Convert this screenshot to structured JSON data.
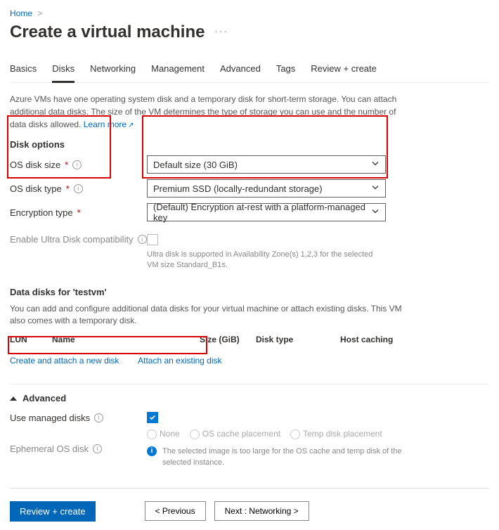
{
  "breadcrumb": {
    "home": "Home"
  },
  "title": "Create a virtual machine",
  "tabs": [
    "Basics",
    "Disks",
    "Networking",
    "Management",
    "Advanced",
    "Tags",
    "Review + create"
  ],
  "active_tab": "Disks",
  "intro": {
    "text": "Azure VMs have one operating system disk and a temporary disk for short-term storage. You can attach additional data disks. The size of the VM determines the type of storage you can use and the number of data disks allowed.",
    "learn_more": "Learn more"
  },
  "disk_options_title": "Disk options",
  "fields": {
    "os_disk_size": {
      "label": "OS disk size",
      "required": true,
      "value": "Default size (30 GiB)"
    },
    "os_disk_type": {
      "label": "OS disk type",
      "required": true,
      "value": "Premium SSD (locally-redundant storage)"
    },
    "encryption_type": {
      "label": "Encryption type",
      "required": true,
      "value": "(Default) Encryption at-rest with a platform-managed key"
    },
    "ultra_disk": {
      "label": "Enable Ultra Disk compatibility",
      "hint": "Ultra disk is supported in Availability Zone(s) 1,2,3 for the selected VM size Standard_B1s."
    }
  },
  "data_disks": {
    "title": "Data disks for 'testvm'",
    "desc": "You can add and configure additional data disks for your virtual machine or attach existing disks. This VM also comes with a temporary disk.",
    "cols": {
      "lun": "LUN",
      "name": "Name",
      "size": "Size (GiB)",
      "type": "Disk type",
      "cache": "Host caching"
    },
    "create_link": "Create and attach a new disk",
    "attach_link": "Attach an existing disk"
  },
  "advanced": {
    "title": "Advanced",
    "use_managed": {
      "label": "Use managed disks",
      "checked": true
    },
    "ephemeral": {
      "label": "Ephemeral OS disk",
      "options": {
        "none": "None",
        "cache": "OS cache placement",
        "temp": "Temp disk placement"
      },
      "note": "The selected image is too large for the OS cache and temp disk of the selected instance."
    }
  },
  "footer": {
    "review": "Review + create",
    "prev": "< Previous",
    "next": "Next : Networking >"
  }
}
